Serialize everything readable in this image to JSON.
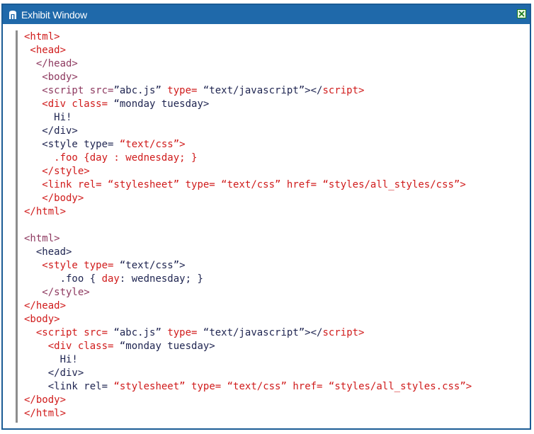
{
  "window": {
    "title": "Exhibit Window",
    "title_icon": "exhibit-icon",
    "close_icon": "close-icon"
  },
  "code_lines": [
    [
      {
        "t": "<html>",
        "c": "r"
      }
    ],
    [
      {
        "t": " <head>",
        "c": "r"
      }
    ],
    [
      {
        "t": "  </head>",
        "c": "t"
      }
    ],
    [
      {
        "t": "   <body>",
        "c": "t"
      }
    ],
    [
      {
        "t": "   <script src=",
        "c": "t"
      },
      {
        "t": "”abc.js” ",
        "c": "n"
      },
      {
        "t": "type=",
        "c": "r"
      },
      {
        "t": " “text/javascript”></",
        "c": "n"
      },
      {
        "t": "script>",
        "c": "r"
      }
    ],
    [
      {
        "t": "   <div class=",
        "c": "r"
      },
      {
        "t": " “monday tuesday>",
        "c": "n"
      }
    ],
    [
      {
        "t": "     Hi!",
        "c": "n"
      }
    ],
    [
      {
        "t": "   </div>",
        "c": "n"
      }
    ],
    [
      {
        "t": "   <style type=",
        "c": "n"
      },
      {
        "t": " “text/css”>",
        "c": "r"
      }
    ],
    [
      {
        "t": "     .foo {day : wednesday; }",
        "c": "r"
      }
    ],
    [
      {
        "t": "   </style>",
        "c": "r"
      }
    ],
    [
      {
        "t": "   <link rel=",
        "c": "r"
      },
      {
        "t": " “stylesheet” ",
        "c": "r"
      },
      {
        "t": "type=",
        "c": "r"
      },
      {
        "t": " “text/css” ",
        "c": "r"
      },
      {
        "t": "href=",
        "c": "r"
      },
      {
        "t": " “styles/all_styles/css”>",
        "c": "r"
      }
    ],
    [
      {
        "t": "   </body>",
        "c": "r"
      }
    ],
    [
      {
        "t": "</html>",
        "c": "r"
      }
    ],
    [
      {
        "t": "",
        "c": "n"
      }
    ],
    [
      {
        "t": "<html>",
        "c": "t"
      }
    ],
    [
      {
        "t": "  <head>",
        "c": "n"
      }
    ],
    [
      {
        "t": "   <style type=",
        "c": "r"
      },
      {
        "t": " “text/css”>",
        "c": "n"
      }
    ],
    [
      {
        "t": "      .foo { ",
        "c": "n"
      },
      {
        "t": "day",
        "c": "r"
      },
      {
        "t": ": wednesday; }",
        "c": "n"
      }
    ],
    [
      {
        "t": "   </style>",
        "c": "t"
      }
    ],
    [
      {
        "t": "</head>",
        "c": "r"
      }
    ],
    [
      {
        "t": "<body>",
        "c": "r"
      }
    ],
    [
      {
        "t": "  <script src=",
        "c": "r"
      },
      {
        "t": " “abc.js” ",
        "c": "n"
      },
      {
        "t": "type=",
        "c": "r"
      },
      {
        "t": " “text/javascript”></",
        "c": "n"
      },
      {
        "t": "script>",
        "c": "r"
      }
    ],
    [
      {
        "t": "    <div class=",
        "c": "r"
      },
      {
        "t": " “monday tuesday>",
        "c": "n"
      }
    ],
    [
      {
        "t": "      Hi!",
        "c": "n"
      }
    ],
    [
      {
        "t": "    </div>",
        "c": "n"
      }
    ],
    [
      {
        "t": "    <link rel=",
        "c": "n"
      },
      {
        "t": " “stylesheet” ",
        "c": "r"
      },
      {
        "t": "type=",
        "c": "r"
      },
      {
        "t": " “text/css” ",
        "c": "r"
      },
      {
        "t": "href=",
        "c": "r"
      },
      {
        "t": " “styles/all_styles.css”>",
        "c": "r"
      }
    ],
    [
      {
        "t": "</body>",
        "c": "r"
      }
    ],
    [
      {
        "t": "</html>",
        "c": "r"
      }
    ]
  ]
}
